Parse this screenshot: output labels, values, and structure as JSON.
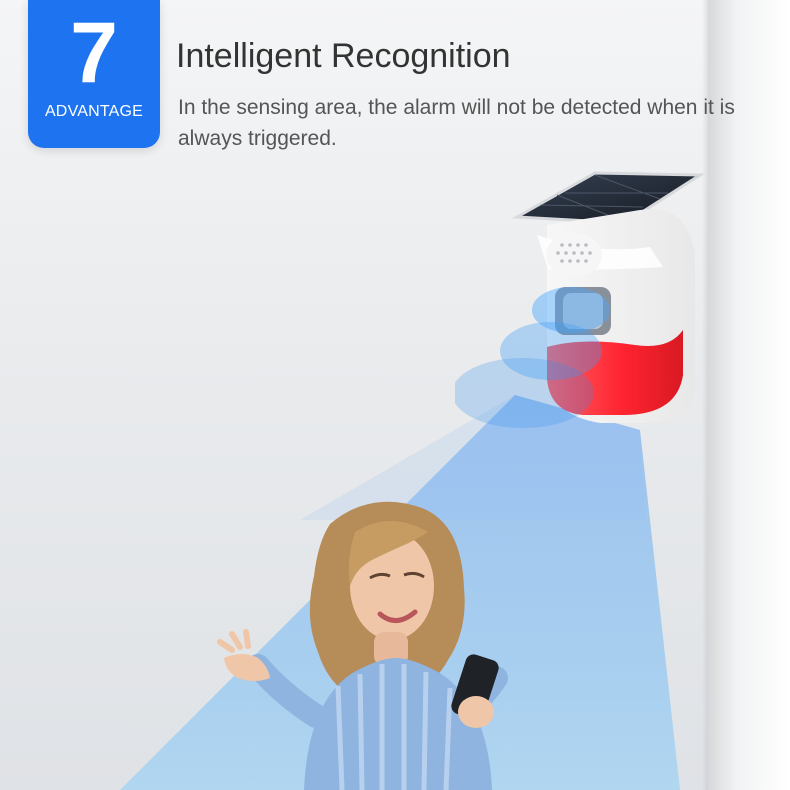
{
  "badge": {
    "number": "7",
    "label": "ADVANTAGE",
    "color": "#1e74f0"
  },
  "feature": {
    "title": "Intelligent Recognition",
    "description": "In the sensing area, the alarm will not be detected when it is always triggered."
  },
  "device": {
    "light_color": "#ff2430",
    "body_color": "#ffffff",
    "panel_color": "#1f2530"
  },
  "icons": {
    "solar": "solar-panel-icon",
    "speaker": "speaker-grille-icon",
    "sensor": "motion-sensor-icon"
  }
}
